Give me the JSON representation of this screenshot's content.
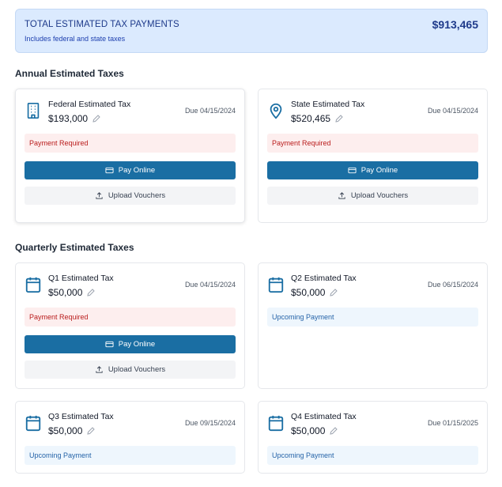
{
  "summary": {
    "title": "TOTAL ESTIMATED TAX PAYMENTS",
    "subtitle": "Includes federal and state taxes",
    "amount": "$913,465"
  },
  "sections": {
    "annual": "Annual Estimated Taxes",
    "quarterly": "Quarterly Estimated Taxes"
  },
  "buttons": {
    "pay": "Pay Online",
    "upload": "Upload Vouchers"
  },
  "status": {
    "required": "Payment Required",
    "upcoming": "Upcoming Payment"
  },
  "cards": {
    "federal": {
      "name": "Federal Estimated Tax",
      "amount": "$193,000",
      "due": "Due 04/15/2024",
      "icon": "building-icon"
    },
    "state": {
      "name": "State Estimated Tax",
      "amount": "$520,465",
      "due": "Due 04/15/2024",
      "icon": "map-pin-icon"
    },
    "q1": {
      "name": "Q1 Estimated Tax",
      "amount": "$50,000",
      "due": "Due 04/15/2024",
      "icon": "calendar-icon"
    },
    "q2": {
      "name": "Q2 Estimated Tax",
      "amount": "$50,000",
      "due": "Due 06/15/2024",
      "icon": "calendar-icon"
    },
    "q3": {
      "name": "Q3 Estimated Tax",
      "amount": "$50,000",
      "due": "Due 09/15/2024",
      "icon": "calendar-icon"
    },
    "q4": {
      "name": "Q4 Estimated Tax",
      "amount": "$50,000",
      "due": "Due 01/15/2025",
      "icon": "calendar-icon"
    }
  },
  "colors": {
    "accent": "#1a6ea3",
    "summary_bg": "#dbeafe",
    "required_bg": "#fdeeee",
    "required_text": "#b91c1c",
    "upcoming_bg": "#eef6fd",
    "upcoming_text": "#2563a8"
  }
}
